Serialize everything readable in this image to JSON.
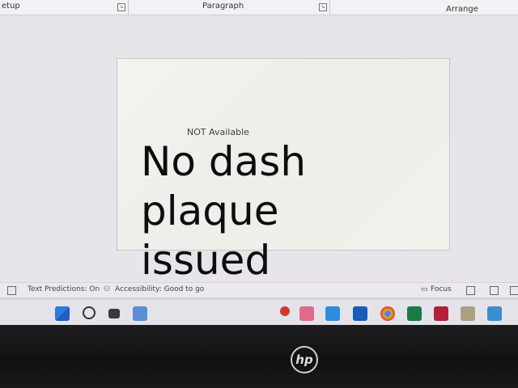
{
  "ribbon": {
    "group_left": "etup",
    "group_paragraph": "Paragraph",
    "group_arrange": "Arrange"
  },
  "slide": {
    "text": "NOT Available"
  },
  "statusbar": {
    "text_predictions": "Text Predictions: On",
    "accessibility": "Accessibility: Good to go",
    "focus": "Focus"
  },
  "overlay": {
    "lines": [
      "No dash",
      "plaque",
      "issued"
    ]
  },
  "brand": {
    "logo_text": "hp"
  },
  "taskbar": {
    "icons": [
      "start-icon",
      "search-icon",
      "widgets-icon",
      "task-icon",
      "notification-icon",
      "snip-icon",
      "todo-icon",
      "word-icon",
      "chrome-icon",
      "excel-icon",
      "access-icon",
      "paint-icon",
      "photos-icon"
    ]
  }
}
